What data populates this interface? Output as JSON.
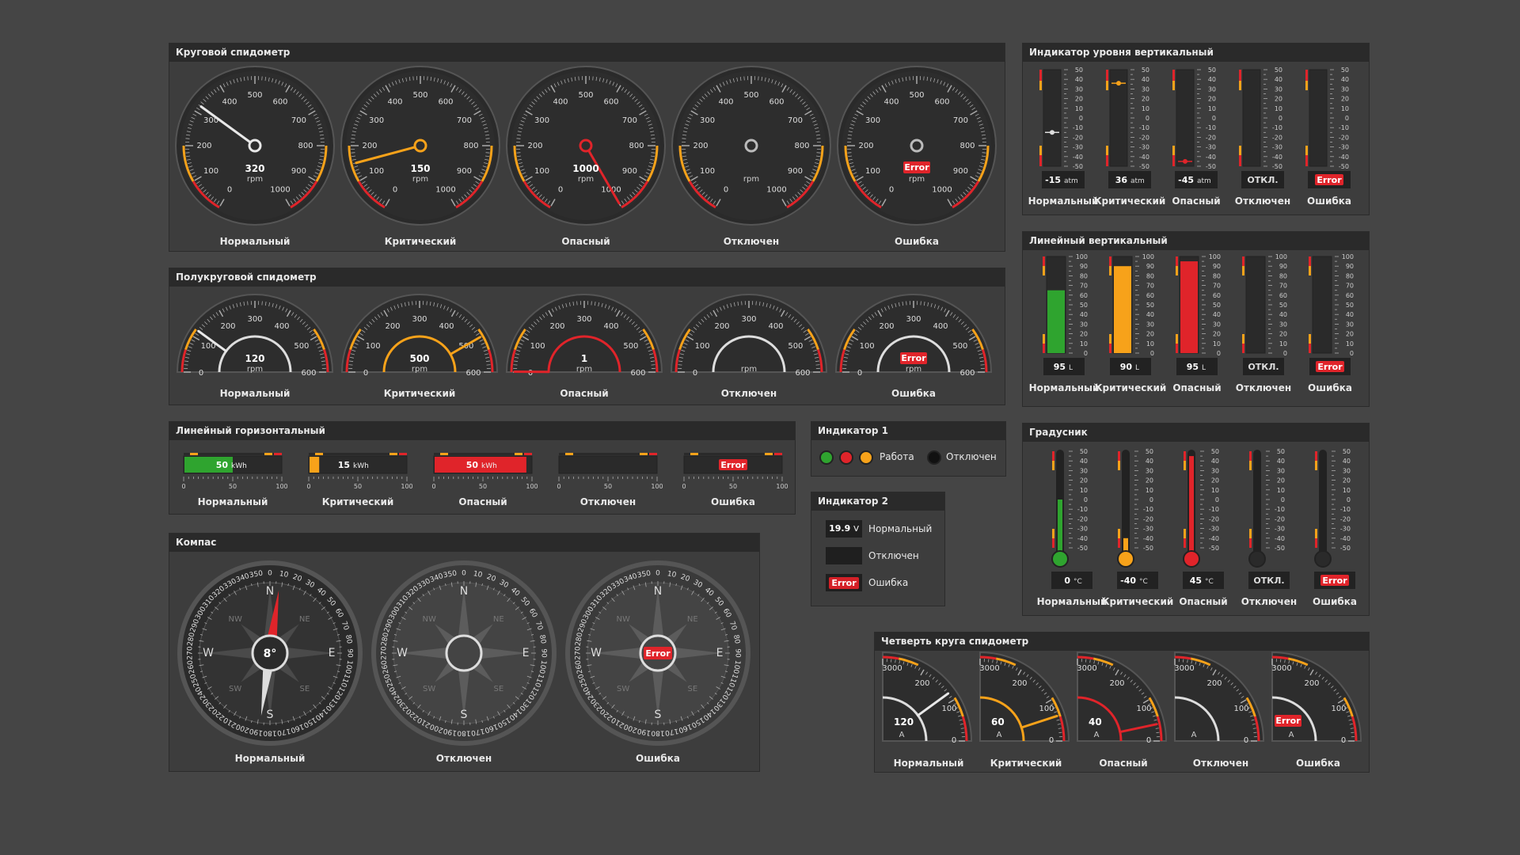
{
  "colors": {
    "green": "#2fa42f",
    "orange": "#f7a21a",
    "red": "#e0242a",
    "bg": "#454545",
    "panel": "#3d3d3d"
  },
  "states": [
    "Нормальный",
    "Критический",
    "Опасный",
    "Отключен",
    "Ошибка"
  ],
  "error_label": "Error",
  "round": {
    "title": "Круговой спидометр",
    "ticks": [
      "0",
      "100",
      "200",
      "300",
      "400",
      "500",
      "600",
      "700",
      "800",
      "900",
      "1000"
    ],
    "unit": "rpm",
    "values": [
      "320",
      "150",
      "1000",
      "",
      ""
    ]
  },
  "semi": {
    "title": "Полукруговой спидометр",
    "ticks": [
      "0",
      "100",
      "200",
      "300",
      "400",
      "500",
      "600"
    ],
    "unit": "rpm",
    "values": [
      "120",
      "500",
      "1",
      "",
      ""
    ]
  },
  "hbar": {
    "title": "Линейный горизонтальный",
    "ticks": [
      "0",
      "50",
      "100"
    ],
    "unit": "kWh",
    "values": [
      "50",
      "15",
      "50",
      "",
      ""
    ],
    "fill": [
      0.5,
      0.1,
      0.95,
      0,
      0
    ]
  },
  "ind1": {
    "title": "Индикатор 1",
    "work": "Работа",
    "off": "Отключен"
  },
  "ind2": {
    "title": "Индикатор 2",
    "value": "19.9",
    "unit": "V",
    "normal": "Нормальный",
    "off": "Отключен",
    "error": "Ошибка"
  },
  "compass": {
    "title": "Компас",
    "value": "8°",
    "letters": [
      "N",
      "NE",
      "E",
      "SE",
      "S",
      "SW",
      "W",
      "NW"
    ],
    "degrees": [
      "0",
      "10",
      "20",
      "30",
      "40",
      "50",
      "60",
      "70",
      "80",
      "90",
      "100",
      "110",
      "120",
      "130",
      "140",
      "150",
      "160",
      "170",
      "180",
      "190",
      "200",
      "210",
      "220",
      "230",
      "240",
      "250",
      "260",
      "270",
      "280",
      "290",
      "300",
      "310",
      "320",
      "330",
      "340",
      "350"
    ],
    "captions": [
      "Нормальный",
      "Отключен",
      "Ошибка"
    ]
  },
  "vlevel": {
    "title": "Индикатор уровня вертикальный",
    "ticks": [
      "50",
      "40",
      "30",
      "20",
      "10",
      "0",
      "-10",
      "-20",
      "-30",
      "-40",
      "-50"
    ],
    "unit": "atm",
    "values": [
      "-15",
      "36",
      "-45",
      "ОТКЛ.",
      ""
    ],
    "captions": [
      "Нормальный",
      "Критический",
      "Опасный",
      "Отключен",
      "Ошибка"
    ]
  },
  "vlin": {
    "title": "Линейный вертикальный",
    "ticks": [
      "100",
      "90",
      "80",
      "70",
      "60",
      "50",
      "40",
      "30",
      "20",
      "10",
      "0"
    ],
    "unit": "L",
    "values": [
      "95",
      "90",
      "95",
      "ОТКЛ.",
      ""
    ],
    "fill": [
      0.65,
      0.9,
      0.95,
      0,
      0
    ]
  },
  "thermo": {
    "title": "Градусник",
    "ticks": [
      "50",
      "40",
      "30",
      "20",
      "10",
      "0",
      "-10",
      "-20",
      "-30",
      "-40",
      "-50"
    ],
    "unit": "°C",
    "values": [
      "0",
      "-40",
      "45",
      "ОТКЛ.",
      ""
    ],
    "fill": [
      0.5,
      0.1,
      0.95,
      0,
      0
    ]
  },
  "quarter": {
    "title": "Четверть круга спидометр",
    "ticks": [
      "0",
      "100",
      "200",
      "3000"
    ],
    "unit": "A",
    "values": [
      "120",
      "60",
      "40",
      "",
      ""
    ]
  }
}
